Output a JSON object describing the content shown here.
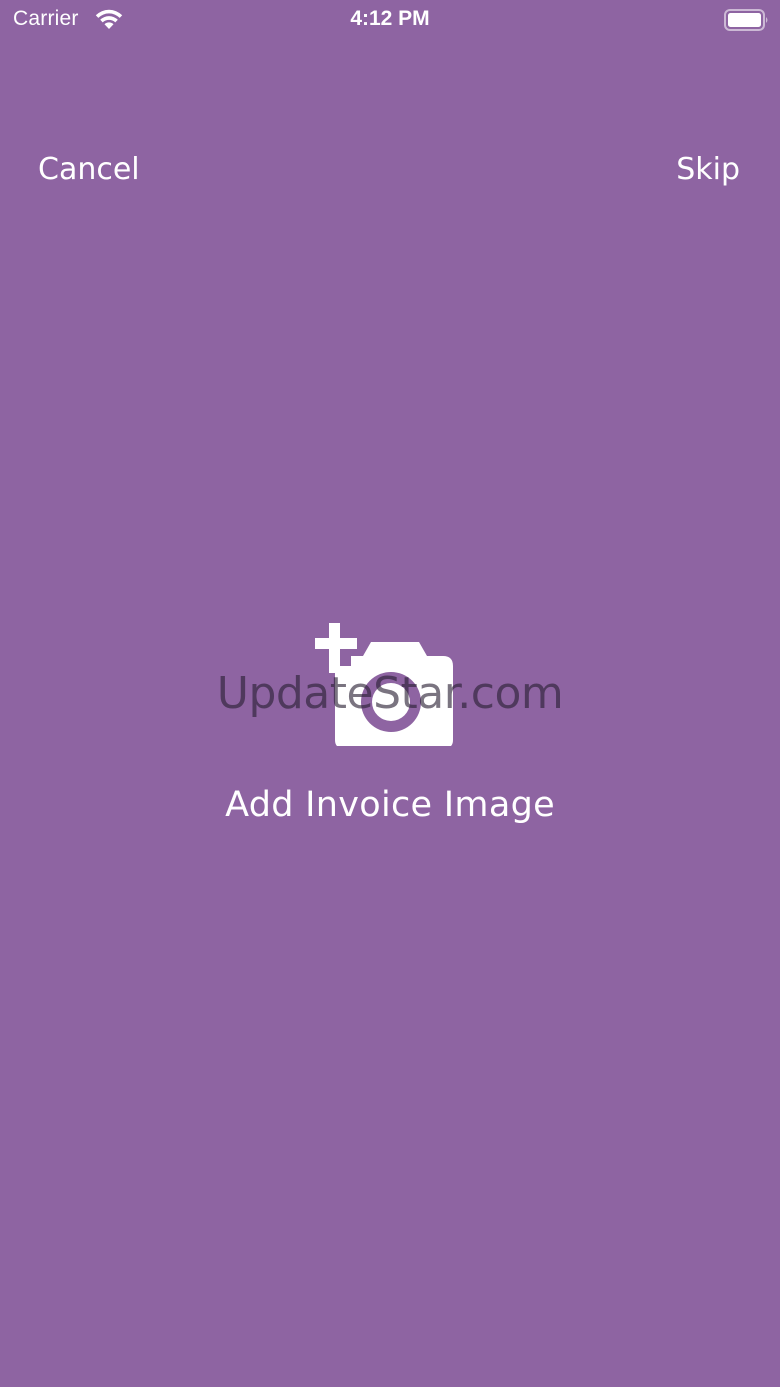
{
  "status_bar": {
    "carrier": "Carrier",
    "time": "4:12 PM",
    "wifi_icon": "wifi-icon",
    "battery_icon": "battery-icon"
  },
  "nav": {
    "cancel_label": "Cancel",
    "skip_label": "Skip"
  },
  "main": {
    "camera_icon": "add-camera-icon",
    "add_label": "Add Invoice Image"
  },
  "watermark": "UpdateStar.com",
  "colors": {
    "background": "#8e64a2",
    "foreground": "#ffffff"
  }
}
